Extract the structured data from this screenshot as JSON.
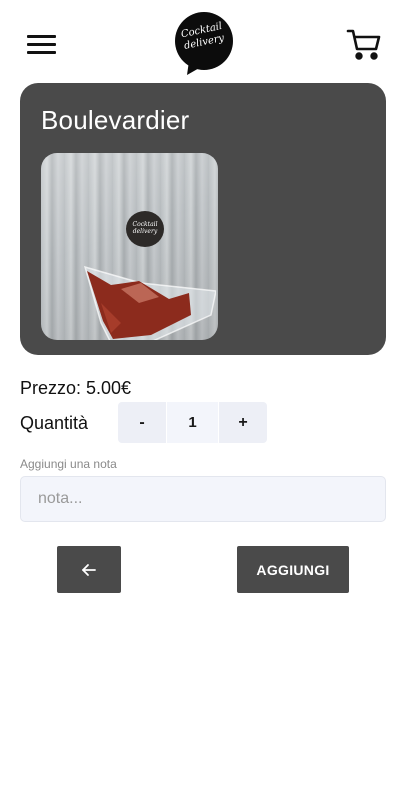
{
  "header": {
    "menu_icon": "hamburger-menu-icon",
    "logo_text_line1": "Cocktail",
    "logo_text_line2": "delivery",
    "cart_icon": "shopping-cart-icon"
  },
  "product": {
    "name": "Boulevardier",
    "image_alt": "cocktail bag on wooden table",
    "sticker_line1": "Cocktail",
    "sticker_line2": "delivery"
  },
  "price": {
    "label": "Prezzo: 5.00€"
  },
  "quantity": {
    "label": "Quantità",
    "minus_label": "-",
    "value": "1",
    "plus_label": "+"
  },
  "note": {
    "label": "Aggiungi una nota",
    "placeholder": "nota...",
    "value": ""
  },
  "actions": {
    "back_icon": "arrow-left-icon",
    "add_label": "AGGIUNGI"
  },
  "colors": {
    "card_bg": "#4a4a4a",
    "button_bg": "#4a4a4a",
    "stepper_bg": "#edeff6"
  }
}
